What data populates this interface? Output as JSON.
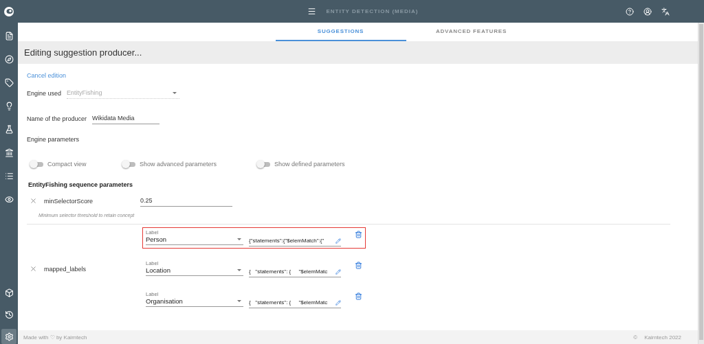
{
  "top_bar": {
    "title": "ENTITY DETECTION (MEDIA)"
  },
  "sidebar": {
    "items": [
      {
        "selected": false
      },
      {
        "selected": false
      },
      {
        "selected": false
      },
      {
        "selected": false
      },
      {
        "selected": false
      },
      {
        "selected": false
      },
      {
        "selected": false
      },
      {
        "selected": false
      }
    ],
    "bottom_items": [
      {
        "selected": false
      },
      {
        "selected": false
      },
      {
        "selected": true
      }
    ]
  },
  "tabs": [
    {
      "label": "SUGGESTIONS",
      "selected": true
    },
    {
      "label": "ADVANCED FEATURES",
      "selected": false
    }
  ],
  "header": "Editing suggestion producer...",
  "cancel_link": "Cancel edition",
  "engine": {
    "label": "Engine used",
    "value": "EntityFishing",
    "disabled": true
  },
  "producer_name": {
    "label": "Name of the producer",
    "value": "Wikidata Media"
  },
  "engine_parameters_title": "Engine parameters",
  "toggles": [
    {
      "label": "Compact view",
      "on": false
    },
    {
      "label": "Show advanced parameters",
      "on": false
    },
    {
      "label": "Show defined parameters",
      "on": false
    }
  ],
  "section_title": "EntityFishing sequence parameters",
  "parameters": [
    {
      "name": "minSelectorScore",
      "value": "0.25",
      "help": "Minimum selector threshold to retain concept"
    }
  ],
  "mapped_labels": {
    "name": "mapped_labels",
    "rows": [
      {
        "caption": "Label",
        "label": "Person",
        "query": "{\"statements\":{\"$elemMatch\":{\"",
        "highlighted": true
      },
      {
        "caption": "Label",
        "label": "Location",
        "query": "{   \"statements\": {     \"$elemMatc",
        "highlighted": false
      },
      {
        "caption": "Label",
        "label": "Organisation",
        "query": "{   \"statements\": {     \"$elemMatc",
        "highlighted": false
      }
    ]
  },
  "footer": {
    "left": "Made with ♡ by Kairntech",
    "copyright": "©",
    "right": "Kairntech 2022"
  }
}
